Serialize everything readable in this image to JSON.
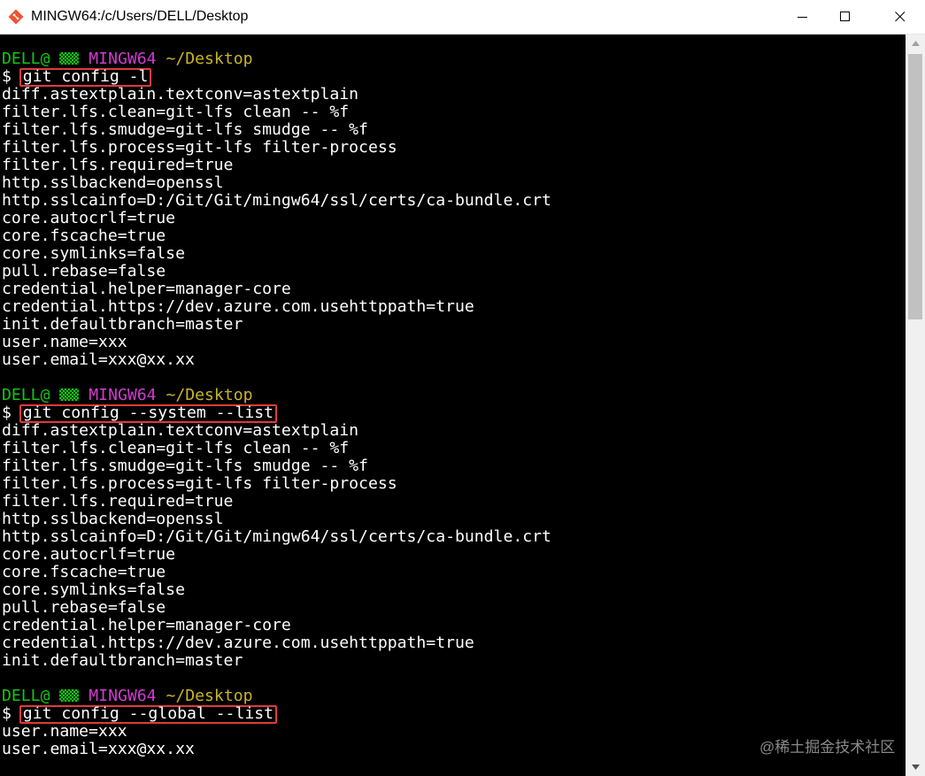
{
  "window": {
    "title": "MINGW64:/c/Users/DELL/Desktop",
    "icon": "git-bash-icon",
    "controls": [
      "minimize-icon",
      "maximize-icon",
      "close-icon"
    ]
  },
  "prompt": {
    "user": "DELL@",
    "host": "MINGW64",
    "path": "~/Desktop",
    "symbol": "$ "
  },
  "sessions": [
    {
      "command": "git config -l",
      "output": [
        "diff.astextplain.textconv=astextplain",
        "filter.lfs.clean=git-lfs clean -- %f",
        "filter.lfs.smudge=git-lfs smudge -- %f",
        "filter.lfs.process=git-lfs filter-process",
        "filter.lfs.required=true",
        "http.sslbackend=openssl",
        "http.sslcainfo=D:/Git/Git/mingw64/ssl/certs/ca-bundle.crt",
        "core.autocrlf=true",
        "core.fscache=true",
        "core.symlinks=false",
        "pull.rebase=false",
        "credential.helper=manager-core",
        "credential.https://dev.azure.com.usehttppath=true",
        "init.defaultbranch=master",
        "user.name=xxx",
        "user.email=xxx@xx.xx"
      ]
    },
    {
      "command": "git config --system --list",
      "output": [
        "diff.astextplain.textconv=astextplain",
        "filter.lfs.clean=git-lfs clean -- %f",
        "filter.lfs.smudge=git-lfs smudge -- %f",
        "filter.lfs.process=git-lfs filter-process",
        "filter.lfs.required=true",
        "http.sslbackend=openssl",
        "http.sslcainfo=D:/Git/Git/mingw64/ssl/certs/ca-bundle.crt",
        "core.autocrlf=true",
        "core.fscache=true",
        "core.symlinks=false",
        "pull.rebase=false",
        "credential.helper=manager-core",
        "credential.https://dev.azure.com.usehttppath=true",
        "init.defaultbranch=master"
      ]
    },
    {
      "command": "git config --global --list",
      "output": [
        "user.name=xxx",
        "user.email=xxx@xx.xx"
      ]
    }
  ],
  "watermark": "@稀土掘金技术社区",
  "colors": {
    "terminal_bg": "#000000",
    "terminal_fg": "#ffffff",
    "prompt_user": "#13c613",
    "prompt_host": "#d23ad2",
    "prompt_path": "#c8b428",
    "highlight_box": "#e03a3a"
  }
}
